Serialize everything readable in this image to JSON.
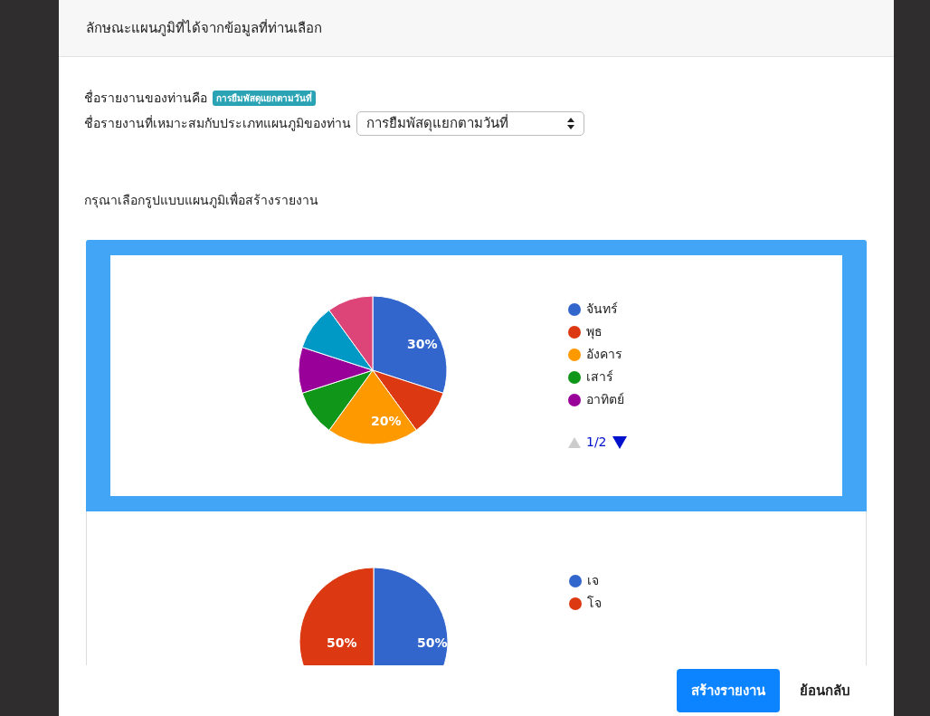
{
  "header": {
    "title": "ลักษณะแผนภูมิที่ได้จากข้อมูลที่ท่านเลือก"
  },
  "report_name": {
    "label": "ชื่อรายงานของท่านคือ",
    "badge": "การยืมพัสดุแยกตามวันที่"
  },
  "suitable_name": {
    "label": "ชื่อรายงานที่เหมาะสมกับประเภทแผนภูมิของท่าน",
    "value": "การยืมพัสดุแยกตามวันที่"
  },
  "prompt": "กรุณาเลือกรูปแบบแผนภูมิเพื่อสร้างรายงาน",
  "charts": [
    {
      "selected": true,
      "kind": "seven",
      "slice_labels": [
        "30%",
        "20%"
      ],
      "legend": [
        {
          "label": "จันทร์",
          "color": "#3366cc"
        },
        {
          "label": "พุธ",
          "color": "#dc3912"
        },
        {
          "label": "อังคาร",
          "color": "#ff9900"
        },
        {
          "label": "เสาร์",
          "color": "#109618"
        },
        {
          "label": "อาทิตย์",
          "color": "#990099"
        }
      ],
      "pager": "1/2"
    },
    {
      "selected": false,
      "kind": "halves",
      "slice_labels": [
        "50%",
        "50%"
      ],
      "legend": [
        {
          "label": "เจ",
          "color": "#3366cc"
        },
        {
          "label": "โจ",
          "color": "#dc3912"
        }
      ]
    }
  ],
  "buttons": {
    "create": "สร้างรายงาน",
    "back": "ย้อนกลับ"
  }
}
